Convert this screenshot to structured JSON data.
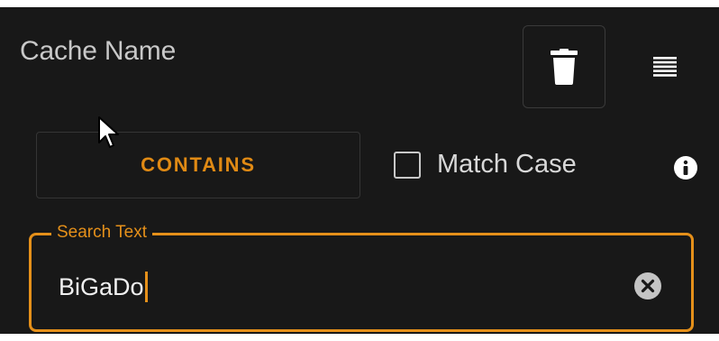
{
  "filter": {
    "title": "Cache Name",
    "operator_label": "CONTAINS",
    "match_case_label": "Match Case",
    "match_case_checked": false,
    "search": {
      "legend": "Search Text",
      "value": "BiGaDo"
    }
  },
  "icons": {
    "delete": "trash-icon",
    "menu": "drag-handle-icon",
    "info": "info-icon",
    "clear": "clear-icon",
    "cursor": "mouse-cursor-icon"
  },
  "colors": {
    "background": "#181818",
    "accent": "#e5901a",
    "text": "#d8d8d8"
  }
}
